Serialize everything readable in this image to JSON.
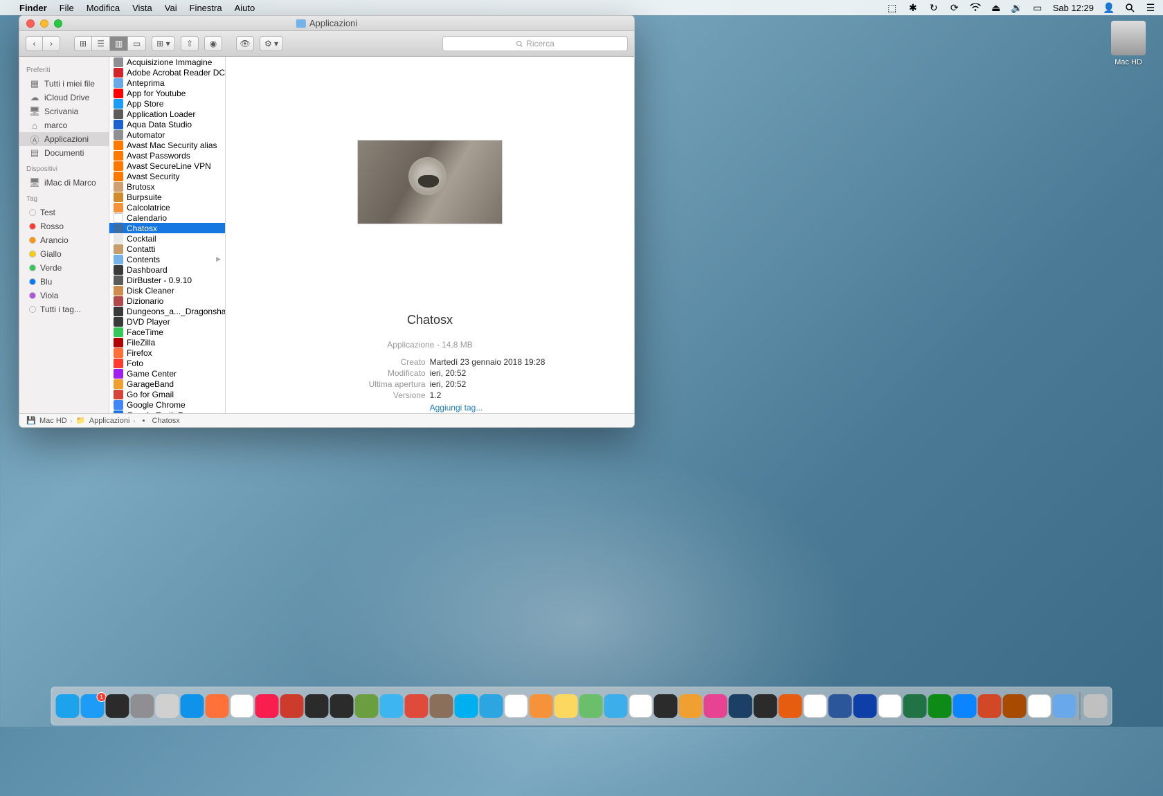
{
  "menubar": {
    "app": "Finder",
    "items": [
      "File",
      "Modifica",
      "Vista",
      "Vai",
      "Finestra",
      "Aiuto"
    ],
    "right_day": "Sab",
    "right_time": "12:29"
  },
  "desktop": {
    "disk": "Mac HD"
  },
  "window": {
    "title": "Applicazioni",
    "search_placeholder": "Ricerca"
  },
  "sidebar": {
    "sections": {
      "favorites": "Preferiti",
      "devices": "Dispositivi",
      "tags": "Tag"
    },
    "favorites": [
      "Tutti i miei file",
      "iCloud Drive",
      "Scrivania",
      "marco",
      "Applicazioni",
      "Documenti"
    ],
    "favorites_selected": 4,
    "devices": [
      "iMac di Marco"
    ],
    "tags": [
      {
        "label": "Test",
        "color": "transparent"
      },
      {
        "label": "Rosso",
        "color": "#ff3b30"
      },
      {
        "label": "Arancio",
        "color": "#ff9500"
      },
      {
        "label": "Giallo",
        "color": "#ffcc00"
      },
      {
        "label": "Verde",
        "color": "#34c759"
      },
      {
        "label": "Blu",
        "color": "#007aff"
      },
      {
        "label": "Viola",
        "color": "#af52de"
      },
      {
        "label": "Tutti i tag...",
        "color": "transparent"
      }
    ]
  },
  "files": [
    {
      "name": "Acquisizione Immagine",
      "c": "#8e8e93"
    },
    {
      "name": "Adobe Acrobat Reader DC",
      "c": "#d2232a"
    },
    {
      "name": "Anteprima",
      "c": "#6aa9e9"
    },
    {
      "name": "App for Youtube",
      "c": "#ff0000"
    },
    {
      "name": "App Store",
      "c": "#1c9cf6"
    },
    {
      "name": "Application Loader",
      "c": "#5b5b5b"
    },
    {
      "name": "Aqua Data Studio",
      "c": "#1e62d0"
    },
    {
      "name": "Automator",
      "c": "#8e8e93"
    },
    {
      "name": "Avast Mac Security alias",
      "c": "#ff7800"
    },
    {
      "name": "Avast Passwords",
      "c": "#ff7800"
    },
    {
      "name": "Avast SecureLine VPN",
      "c": "#ff7800"
    },
    {
      "name": "Avast Security",
      "c": "#ff7800"
    },
    {
      "name": "Brutosx",
      "c": "#d0a070"
    },
    {
      "name": "Burpsuite",
      "c": "#cf8b2c"
    },
    {
      "name": "Calcolatrice",
      "c": "#f6923a"
    },
    {
      "name": "Calendario",
      "c": "#ffffff"
    },
    {
      "name": "Chatosx",
      "c": "#3b6ea5",
      "selected": true
    },
    {
      "name": "Cocktail",
      "c": "#e8e8e8"
    },
    {
      "name": "Contatti",
      "c": "#c69c6d"
    },
    {
      "name": "Contents",
      "c": "#74b2e8",
      "folder": true
    },
    {
      "name": "Dashboard",
      "c": "#3a3a3a"
    },
    {
      "name": "DirBuster - 0.9.10",
      "c": "#5b5b5b"
    },
    {
      "name": "Disk Cleaner",
      "c": "#d08b4e"
    },
    {
      "name": "Dizionario",
      "c": "#b04a4a"
    },
    {
      "name": "Dungeons_a..._Dragonshard",
      "c": "#3a3a3a"
    },
    {
      "name": "DVD Player",
      "c": "#3a3a3a"
    },
    {
      "name": "FaceTime",
      "c": "#34c759"
    },
    {
      "name": "FileZilla",
      "c": "#b00000"
    },
    {
      "name": "Firefox",
      "c": "#ff7139"
    },
    {
      "name": "Foto",
      "c": "#ff3b30"
    },
    {
      "name": "Game Center",
      "c": "#a020f0"
    },
    {
      "name": "GarageBand",
      "c": "#f0a030"
    },
    {
      "name": "Go for Gmail",
      "c": "#d44638"
    },
    {
      "name": "Google Chrome",
      "c": "#4285f4"
    },
    {
      "name": "Google Earth Pro",
      "c": "#1c73e8"
    }
  ],
  "preview": {
    "title": "Chatosx",
    "type_size": "Applicazione - 14,8 MB",
    "rows": [
      {
        "k": "Creato",
        "v": "Martedì 23 gennaio 2018 19:28"
      },
      {
        "k": "Modificato",
        "v": "ieri, 20:52"
      },
      {
        "k": "Ultima apertura",
        "v": "ieri, 20:52"
      },
      {
        "k": "Versione",
        "v": "1.2"
      }
    ],
    "add_tag": "Aggiungi tag..."
  },
  "pathbar": [
    "Mac HD",
    "Applicazioni",
    "Chatosx"
  ],
  "dock": [
    {
      "name": "finder",
      "bg": "#1ca3ec"
    },
    {
      "name": "appstore",
      "bg": "#1c9cf6",
      "badge": "1"
    },
    {
      "name": "activity",
      "bg": "#2b2b2b"
    },
    {
      "name": "sysprefs",
      "bg": "#8e8e93"
    },
    {
      "name": "launchpad",
      "bg": "#d0d0d0"
    },
    {
      "name": "safari",
      "bg": "#0f93ea"
    },
    {
      "name": "firefox",
      "bg": "#ff7139"
    },
    {
      "name": "chrome",
      "bg": "#ffffff"
    },
    {
      "name": "opera",
      "bg": "#fa1e4e"
    },
    {
      "name": "clamxav",
      "bg": "#cc3b2b"
    },
    {
      "name": "terminal",
      "bg": "#2b2b2b"
    },
    {
      "name": "iterm",
      "bg": "#2b2b2b"
    },
    {
      "name": "xquartz",
      "bg": "#6b9e3f"
    },
    {
      "name": "messages",
      "bg": "#3cb5f0"
    },
    {
      "name": "image2icon",
      "bg": "#e04a3a"
    },
    {
      "name": "gimp",
      "bg": "#8a705a"
    },
    {
      "name": "skype",
      "bg": "#00aff0"
    },
    {
      "name": "telegram",
      "bg": "#2ca5e0"
    },
    {
      "name": "calendar",
      "bg": "#ffffff"
    },
    {
      "name": "calculator",
      "bg": "#f6923a"
    },
    {
      "name": "notes",
      "bg": "#fcd861"
    },
    {
      "name": "maps",
      "bg": "#6bbf6b"
    },
    {
      "name": "mail",
      "bg": "#3caeea"
    },
    {
      "name": "photos",
      "bg": "#ffffff"
    },
    {
      "name": "istarmusic",
      "bg": "#2b2b2b"
    },
    {
      "name": "garageband",
      "bg": "#f0a030"
    },
    {
      "name": "itunes",
      "bg": "#e84393"
    },
    {
      "name": "tunein",
      "bg": "#1c3f66"
    },
    {
      "name": "miro",
      "bg": "#2b2b2b"
    },
    {
      "name": "vlc",
      "bg": "#e85c0f"
    },
    {
      "name": "pages",
      "bg": "#ffffff"
    },
    {
      "name": "word",
      "bg": "#2b579a"
    },
    {
      "name": "writer",
      "bg": "#0e3fa9"
    },
    {
      "name": "numbers",
      "bg": "#ffffff"
    },
    {
      "name": "excel",
      "bg": "#217346"
    },
    {
      "name": "calc",
      "bg": "#0e8a16"
    },
    {
      "name": "keynote",
      "bg": "#0a84ff"
    },
    {
      "name": "powerpoint",
      "bg": "#d24726"
    },
    {
      "name": "impress",
      "bg": "#a64b00"
    },
    {
      "name": "textedit",
      "bg": "#ffffff"
    },
    {
      "name": "preview",
      "bg": "#6aa9e9"
    },
    {
      "name": "trash",
      "bg": "#c0c0c0",
      "sep_before": true
    }
  ]
}
